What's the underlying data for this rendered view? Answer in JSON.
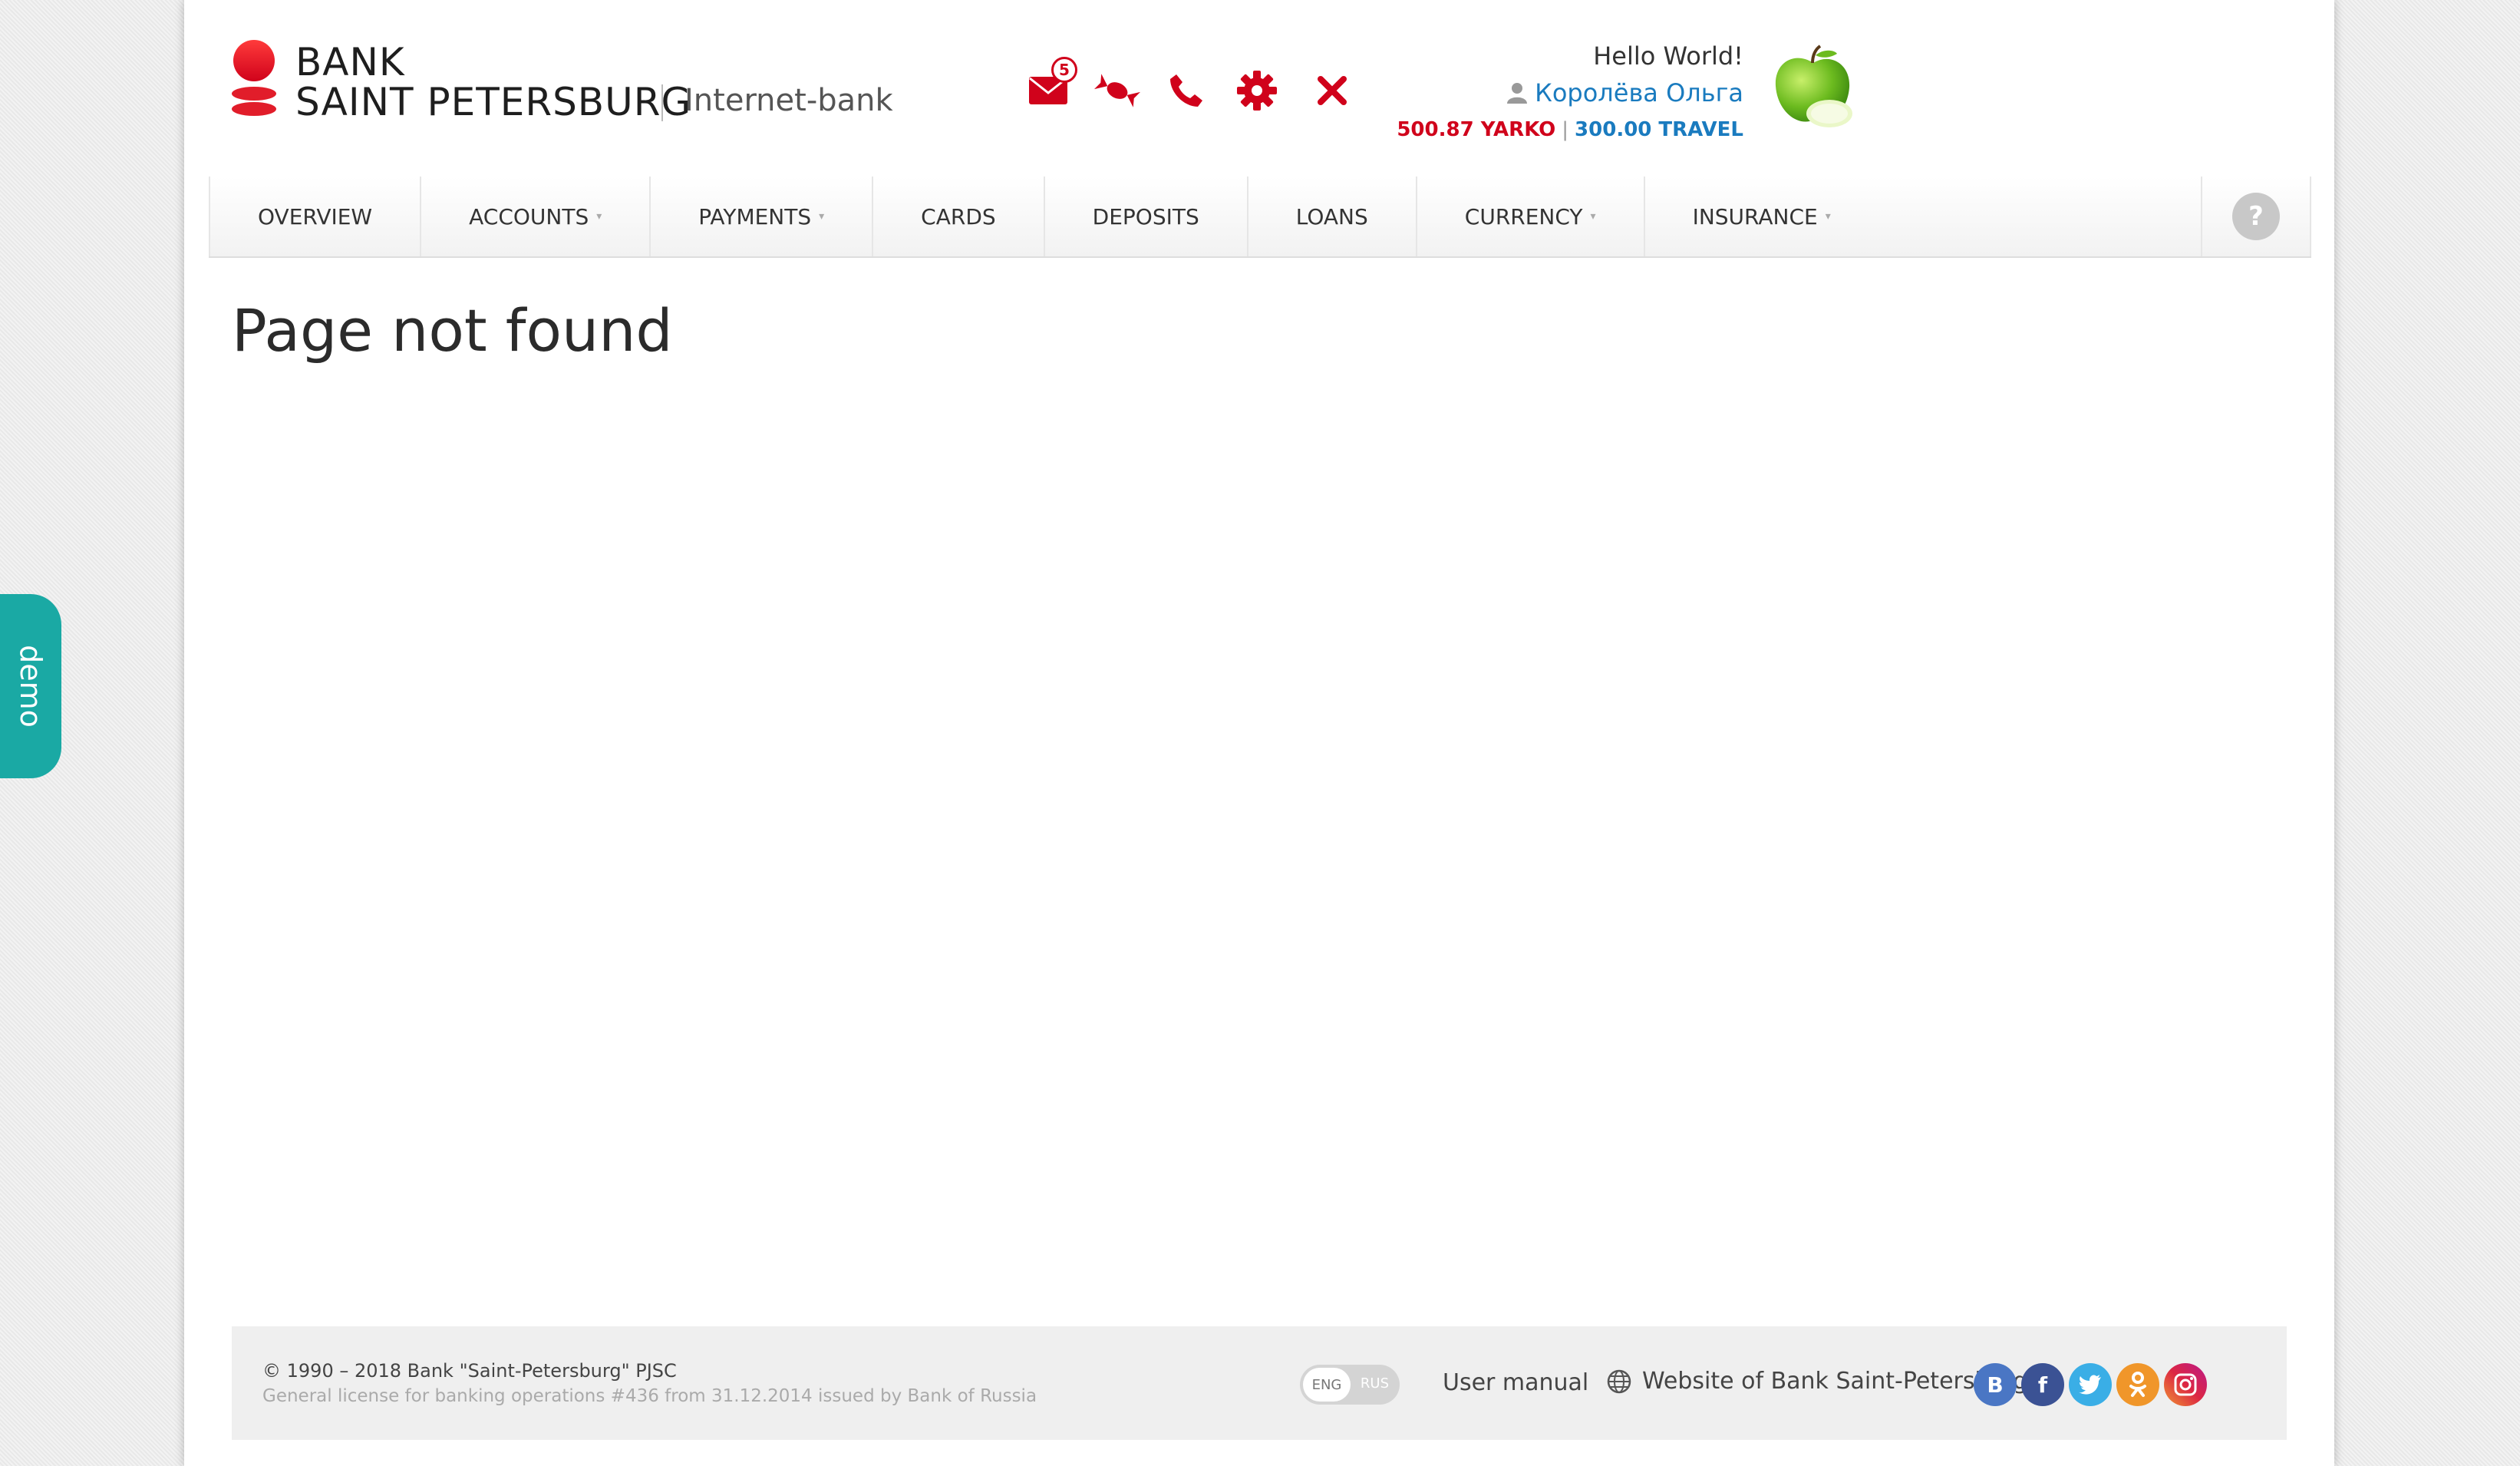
{
  "brand": {
    "line1": "BANK",
    "line2": "SAINT PETERSBURG",
    "subtitle": "Internet-bank"
  },
  "user": {
    "greeting": "Hello World!",
    "name": "Королёва Ольга",
    "balance_yarko": "500.87 YARKO",
    "separator": "|",
    "balance_travel": "300.00 TRAVEL"
  },
  "header_icons": {
    "mail_badge": "5",
    "icons": [
      "mail-icon",
      "candy-icon",
      "phone-icon",
      "gear-icon",
      "close-icon"
    ],
    "accent_color": "#d0021b"
  },
  "nav": {
    "items": [
      {
        "label": "OVERVIEW",
        "dropdown": false
      },
      {
        "label": "ACCOUNTS",
        "dropdown": true
      },
      {
        "label": "PAYMENTS",
        "dropdown": true
      },
      {
        "label": "CARDS",
        "dropdown": false
      },
      {
        "label": "DEPOSITS",
        "dropdown": false
      },
      {
        "label": "LOANS",
        "dropdown": false
      },
      {
        "label": "CURRENCY",
        "dropdown": true
      },
      {
        "label": "INSURANCE",
        "dropdown": true
      }
    ],
    "help": "?"
  },
  "main": {
    "title": "Page not found"
  },
  "footer": {
    "copyright": "© 1990 – 2018 Bank \"Saint-Petersburg\" PJSC",
    "license": "General license for banking operations #436 from 31.12.2014 issued by Bank of Russia",
    "lang_eng": "ENG",
    "lang_rus": "RUS",
    "user_manual": "User manual",
    "website": "Website of Bank Saint-Petersburg",
    "social": [
      {
        "name": "vk",
        "glyph": "B",
        "color": "#4a76c4"
      },
      {
        "name": "facebook",
        "glyph": "f",
        "color": "#3b5294"
      },
      {
        "name": "twitter",
        "glyph": "t",
        "color": "#3aaee6"
      },
      {
        "name": "odnoklassniki",
        "glyph": "ok",
        "color": "#f0962a"
      },
      {
        "name": "instagram",
        "glyph": "ig",
        "color": "#b8328a"
      }
    ]
  },
  "demo_tab": "demo"
}
